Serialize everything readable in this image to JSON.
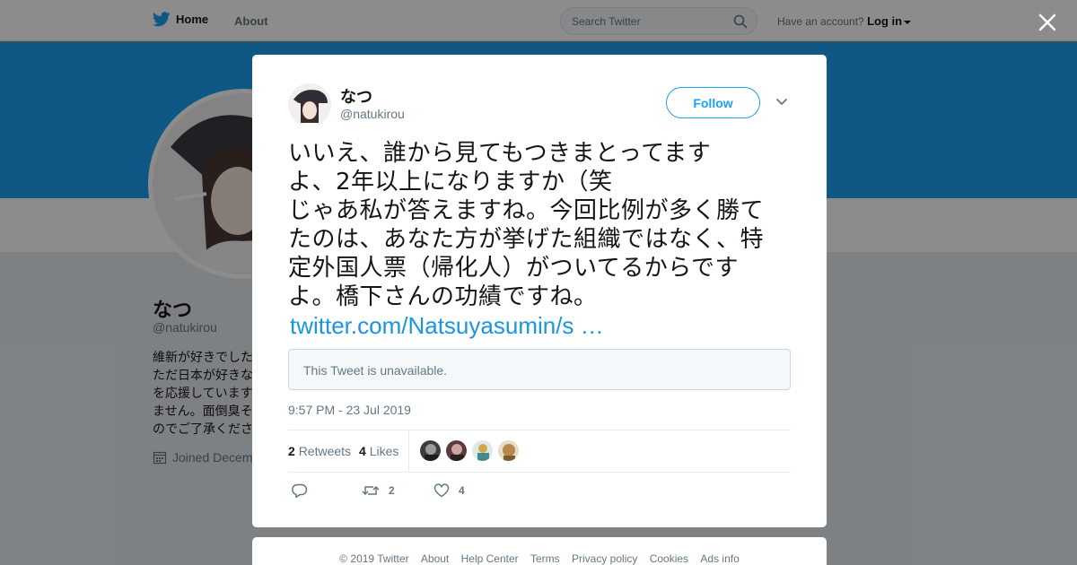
{
  "colors": {
    "brand": "#1da1f2",
    "link": "#1b95e0",
    "text": "#14171a",
    "muted": "#657786"
  },
  "topbar": {
    "home_label": "Home",
    "about_label": "About",
    "search_placeholder": "Search Twitter",
    "account_prompt": "Have an account?",
    "login_label": "Log in"
  },
  "profile": {
    "name": "なつ",
    "handle": "@natukirou",
    "bio_lines": [
      "維新が好きでした",
      "ただ日本が好きな",
      "を応援しています",
      "ません。面倒臭そ",
      "のでご了承くださ"
    ],
    "joined": "Joined Decem"
  },
  "tweet": {
    "name": "なつ",
    "handle": "@natukirou",
    "follow_label": "Follow",
    "text": "いいえ、誰から見てもつきまとってます\nよ、2年以上になりますか（笑\nじゃあ私が答えますね。今回比例が多く勝て\nたのは、あなた方が挙げた組織ではなく、特\n定外国人票（帰化人）がついてるからです\nよ。橋下さんの功績ですね。",
    "link": "twitter.com/Natsuyasumin/s …",
    "quote_unavailable": "This Tweet is unavailable.",
    "timestamp": "9:57 PM - 23 Jul 2019",
    "retweets_count": "2",
    "retweets_label": "Retweets",
    "likes_count": "4",
    "likes_label": "Likes",
    "action_retweet_count": "2",
    "action_like_count": "4"
  },
  "footer": {
    "items": [
      "© 2019 Twitter",
      "About",
      "Help Center",
      "Terms",
      "Privacy policy",
      "Cookies",
      "Ads info"
    ]
  }
}
